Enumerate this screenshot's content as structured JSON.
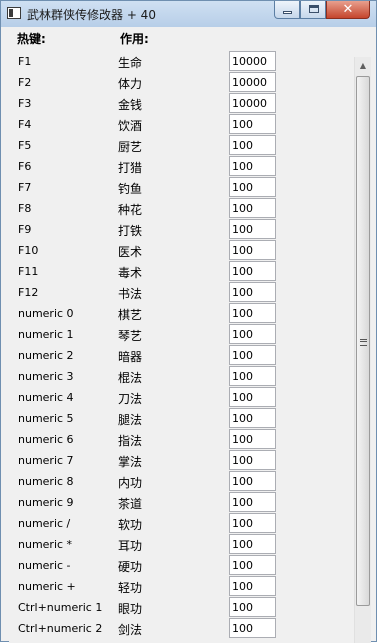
{
  "window": {
    "title": "武林群侠传修改器 + 40"
  },
  "header": {
    "hotkey_label": "热键:",
    "function_label": "作用:"
  },
  "rows": [
    {
      "hotkey": "F1",
      "function": "生命",
      "value": "10000"
    },
    {
      "hotkey": "F2",
      "function": "体力",
      "value": "10000"
    },
    {
      "hotkey": "F3",
      "function": "金钱",
      "value": "10000"
    },
    {
      "hotkey": "F4",
      "function": "饮酒",
      "value": "100"
    },
    {
      "hotkey": "F5",
      "function": "厨艺",
      "value": "100"
    },
    {
      "hotkey": "F6",
      "function": "打猎",
      "value": "100"
    },
    {
      "hotkey": "F7",
      "function": "钓鱼",
      "value": "100"
    },
    {
      "hotkey": "F8",
      "function": "种花",
      "value": "100"
    },
    {
      "hotkey": "F9",
      "function": "打铁",
      "value": "100"
    },
    {
      "hotkey": "F10",
      "function": "医术",
      "value": "100"
    },
    {
      "hotkey": "F11",
      "function": "毒术",
      "value": "100"
    },
    {
      "hotkey": "F12",
      "function": "书法",
      "value": "100"
    },
    {
      "hotkey": "numeric 0",
      "function": "棋艺",
      "value": "100"
    },
    {
      "hotkey": "numeric 1",
      "function": "琴艺",
      "value": "100"
    },
    {
      "hotkey": "numeric 2",
      "function": "暗器",
      "value": "100"
    },
    {
      "hotkey": "numeric 3",
      "function": "棍法",
      "value": "100"
    },
    {
      "hotkey": "numeric 4",
      "function": "刀法",
      "value": "100"
    },
    {
      "hotkey": "numeric 5",
      "function": "腿法",
      "value": "100"
    },
    {
      "hotkey": "numeric 6",
      "function": "指法",
      "value": "100"
    },
    {
      "hotkey": "numeric 7",
      "function": "掌法",
      "value": "100"
    },
    {
      "hotkey": "numeric 8",
      "function": "内功",
      "value": "100"
    },
    {
      "hotkey": "numeric 9",
      "function": "茶道",
      "value": "100"
    },
    {
      "hotkey": "numeric /",
      "function": "软功",
      "value": "100"
    },
    {
      "hotkey": "numeric *",
      "function": "耳功",
      "value": "100"
    },
    {
      "hotkey": "numeric -",
      "function": "硬功",
      "value": "100"
    },
    {
      "hotkey": "numeric +",
      "function": "轻功",
      "value": "100"
    },
    {
      "hotkey": "Ctrl+numeric 1",
      "function": "眼功",
      "value": "100"
    },
    {
      "hotkey": "Ctrl+numeric 2",
      "function": "剑法",
      "value": "100"
    }
  ],
  "colors": {
    "titlebar": "#b7cee8",
    "close_button": "#c5452d",
    "client_bg": "#f0f0f0"
  },
  "icons": {
    "window": "app-window-icon",
    "minimize": "minimize-icon",
    "maximize": "maximize-icon",
    "close": "close-icon",
    "scroll_up": "scroll-up-arrow-icon"
  }
}
